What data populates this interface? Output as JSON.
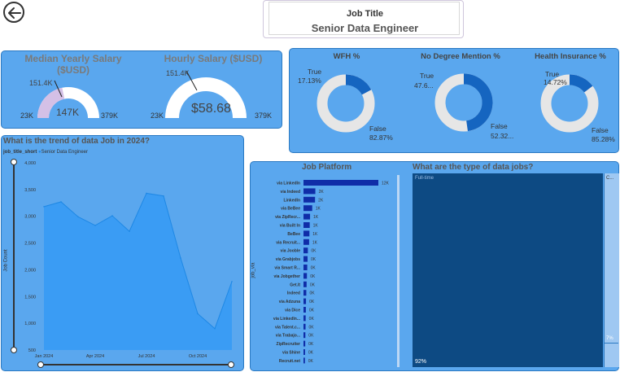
{
  "header": {
    "job_title_label": "Job Title",
    "job_title_value": "Senior Data Engineer"
  },
  "salary_panel": {
    "median": {
      "title_line1": "Median Yearly Salary",
      "title_line2": "($USD)",
      "min": "23K",
      "max": "379K",
      "value": "147K",
      "target": "151.4K",
      "value_num": 147,
      "target_num": 151.4,
      "min_num": 23,
      "max_num": 379
    },
    "hourly": {
      "title": "Hourly Salary ($USD)",
      "min": "23K",
      "max": "379K",
      "value": "$58.68",
      "target": "151.4K",
      "value_num": 151.4,
      "target_num": 151.4,
      "min_num": 23,
      "max_num": 379
    }
  },
  "donuts": [
    {
      "title": "WFH %",
      "true_label": "True",
      "true_value": "17.13%",
      "false_label": "False",
      "false_value": "82.87%",
      "true_pct": 17.13
    },
    {
      "title": "No Degree Mention %",
      "true_label": "True",
      "true_value": "47.6...",
      "false_label": "False",
      "false_value": "52.32...",
      "true_pct": 47.68
    },
    {
      "title": "Health Insurance %",
      "true_label": "True",
      "true_value": "14.72%",
      "false_label": "False",
      "false_value": "85.28%",
      "true_pct": 14.72
    }
  ],
  "colors": {
    "panel_bg": "#5aa7ee",
    "panel_border": "#2b79c2",
    "donut_true": "#1565c0",
    "donut_false": "#e6e6e6",
    "gauge_fill": "#d4c0e6",
    "gauge_track": "#ffffff",
    "bar": "#0f2da8",
    "treemap_main": "#0d4a83",
    "treemap_side": "#9fc8f2"
  },
  "trend": {
    "title": "What is the trend of data Job in 2024?",
    "legend_field": "job_title_short",
    "legend_item": "Senior Data Engineer",
    "y_axis_label": "Job Count"
  },
  "platform": {
    "title": "Job Platform",
    "axis_label": "job_via"
  },
  "treemap": {
    "title": "What are the type of data jobs?",
    "main_label": "Full-time",
    "main_pct": "92%",
    "side_label": "C...",
    "side_pct": "7%"
  },
  "chart_data": [
    {
      "type": "area",
      "title": "What is the trend of data Job in 2024?",
      "xlabel": "",
      "ylabel": "Job Count",
      "x_tick_labels": [
        "Jan 2024",
        "Apr 2024",
        "Jul 2024",
        "Oct 2024"
      ],
      "y_ticks": [
        "4,000",
        "3,500",
        "3,000",
        "2,500",
        "2,000",
        "1,500",
        "1,000",
        "500"
      ],
      "ylim": [
        500,
        4000
      ],
      "series": [
        {
          "name": "Senior Data Engineer",
          "x": [
            "2024-01",
            "2024-02",
            "2024-03",
            "2024-04",
            "2024-05",
            "2024-06",
            "2024-07",
            "2024-08",
            "2024-09",
            "2024-10",
            "2024-11",
            "2024-12"
          ],
          "values": [
            3180,
            3270,
            2990,
            2830,
            3010,
            2720,
            3430,
            3380,
            2220,
            1180,
            900,
            1780
          ]
        }
      ]
    },
    {
      "type": "bar",
      "title": "Job Platform",
      "ylabel": "job_via",
      "orientation": "horizontal",
      "categories": [
        "via LinkedIn",
        "via Indeed",
        "LinkedIn",
        "via BeBee",
        "via ZipRecr...",
        "via Built In",
        "BeBee",
        "via Recruit...",
        "via Jooble",
        "via Grabjobs",
        "via Smart R...",
        "via Jobgether",
        "Get.It",
        "Indeed",
        "via Adzuna",
        "via Dice",
        "via LinkedIn...",
        "via Talent.c...",
        "via Trabajo...",
        "ZipRecruiter",
        "via Shine",
        "Recruit.net"
      ],
      "values": [
        12000,
        2000,
        2000,
        1000,
        1000,
        1000,
        1000,
        1000,
        0,
        0,
        0,
        0,
        0,
        0,
        0,
        0,
        0,
        0,
        0,
        0,
        0,
        0
      ],
      "value_labels": [
        "12K",
        "2K",
        "2K",
        "1K",
        "1K",
        "1K",
        "1K",
        "1K",
        "0K",
        "0K",
        "0K",
        "0K",
        "0K",
        "0K",
        "0K",
        "0K",
        "0K",
        "0K",
        "0K",
        "0K",
        "0K",
        "0K"
      ],
      "display_values": [
        12000,
        1900,
        1850,
        1400,
        1050,
        1000,
        950,
        900,
        700,
        650,
        600,
        550,
        500,
        450,
        400,
        380,
        350,
        330,
        300,
        280,
        250,
        230
      ]
    },
    {
      "type": "treemap",
      "title": "What are the type of data jobs?",
      "categories": [
        "Full-time",
        "C..."
      ],
      "values": [
        92,
        7
      ],
      "value_labels": [
        "92%",
        "7%"
      ]
    }
  ]
}
